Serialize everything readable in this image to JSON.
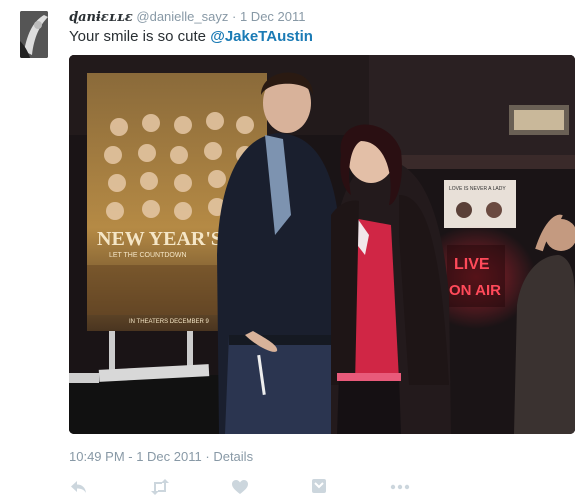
{
  "tweet": {
    "display_name": "ɖanɨɛʟʟɛ",
    "handle": "@danielle_sayz",
    "separator": "·",
    "date": "1 Dec 2011",
    "text_prefix": "Your smile is so cute ",
    "mention": "@JakeTAustin"
  },
  "photo": {
    "poster_title": "NEW YEAR'S",
    "poster_tagline": "LET THE COUNTDOWN",
    "poster_footer": "IN THEATERS DECEMBER 9",
    "neon_line1": "LIVE",
    "neon_line2": "ON AIR",
    "sign_text": "LOVE IS NEVER A LADY"
  },
  "meta": {
    "timestamp": "10:49 PM - 1 Dec 2011",
    "separator": "·",
    "details_label": "Details"
  },
  "actions": {
    "icons": [
      "reply-icon",
      "retweet-icon",
      "like-icon",
      "save-icon",
      "more-icon"
    ],
    "icon_color": "#ccd6dd"
  },
  "colors": {
    "mention": "#1b7bb5",
    "secondary_text": "#8899a6",
    "neon": "#ff2a3c"
  }
}
